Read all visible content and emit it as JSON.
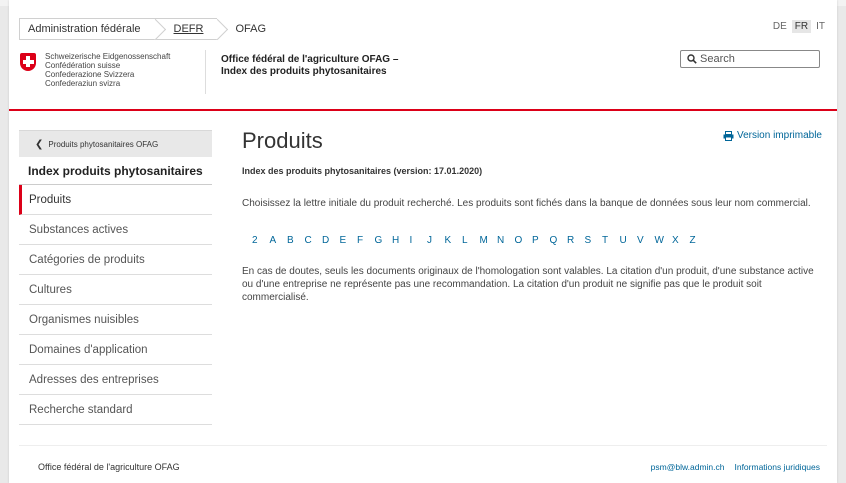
{
  "breadcrumb": {
    "items": [
      "Administration fédérale",
      "DEFR",
      "OFAG"
    ]
  },
  "languages": {
    "items": [
      "DE",
      "FR",
      "IT"
    ],
    "active": "FR"
  },
  "logo": {
    "lines": [
      "Schweizerische Eidgenossenschaft",
      "Confédération suisse",
      "Confederazione Svizzera",
      "Confederaziun svizra"
    ]
  },
  "header": {
    "office_line1": "Office fédéral de l'agriculture OFAG –",
    "office_line2": "Index des produits phytosanitaires"
  },
  "search": {
    "placeholder": "Search"
  },
  "sidebar": {
    "back_label": "Produits phytosanitaires OFAG",
    "heading": "Index produits phytosanitaires",
    "items": [
      "Produits",
      "Substances actives",
      "Catégories de produits",
      "Cultures",
      "Organismes nuisibles",
      "Domaines d'application",
      "Adresses des entreprises",
      "Recherche standard"
    ],
    "active_index": 0
  },
  "main": {
    "title": "Produits",
    "print_label": "Version imprimable",
    "subtitle": "Index des produits phytosanitaires (version: 17.01.2020)",
    "intro": "Choisissez la lettre initiale du produit recherché. Les produits sont fichés dans la banque de données sous leur nom commercial.",
    "letters": [
      "2",
      "A",
      "B",
      "C",
      "D",
      "E",
      "F",
      "G",
      "H",
      "I",
      "J",
      "K",
      "L",
      "M",
      "N",
      "O",
      "P",
      "Q",
      "R",
      "S",
      "T",
      "U",
      "V",
      "W",
      "X",
      "Z"
    ],
    "disclaimer": "En cas de doutes, seuls les documents originaux de l'homologation sont valables. La citation d'un produit, d'une substance active ou d'une entreprise ne représente pas une recommandation. La citation d'un produit ne signifie pas que le produit soit commercialisé."
  },
  "footer": {
    "left": "Office fédéral de l'agriculture OFAG",
    "email": "psm@blw.admin.ch",
    "legal": "Informations juridiques"
  },
  "colors": {
    "accent_red": "#dc0018",
    "link_blue": "#006699"
  }
}
